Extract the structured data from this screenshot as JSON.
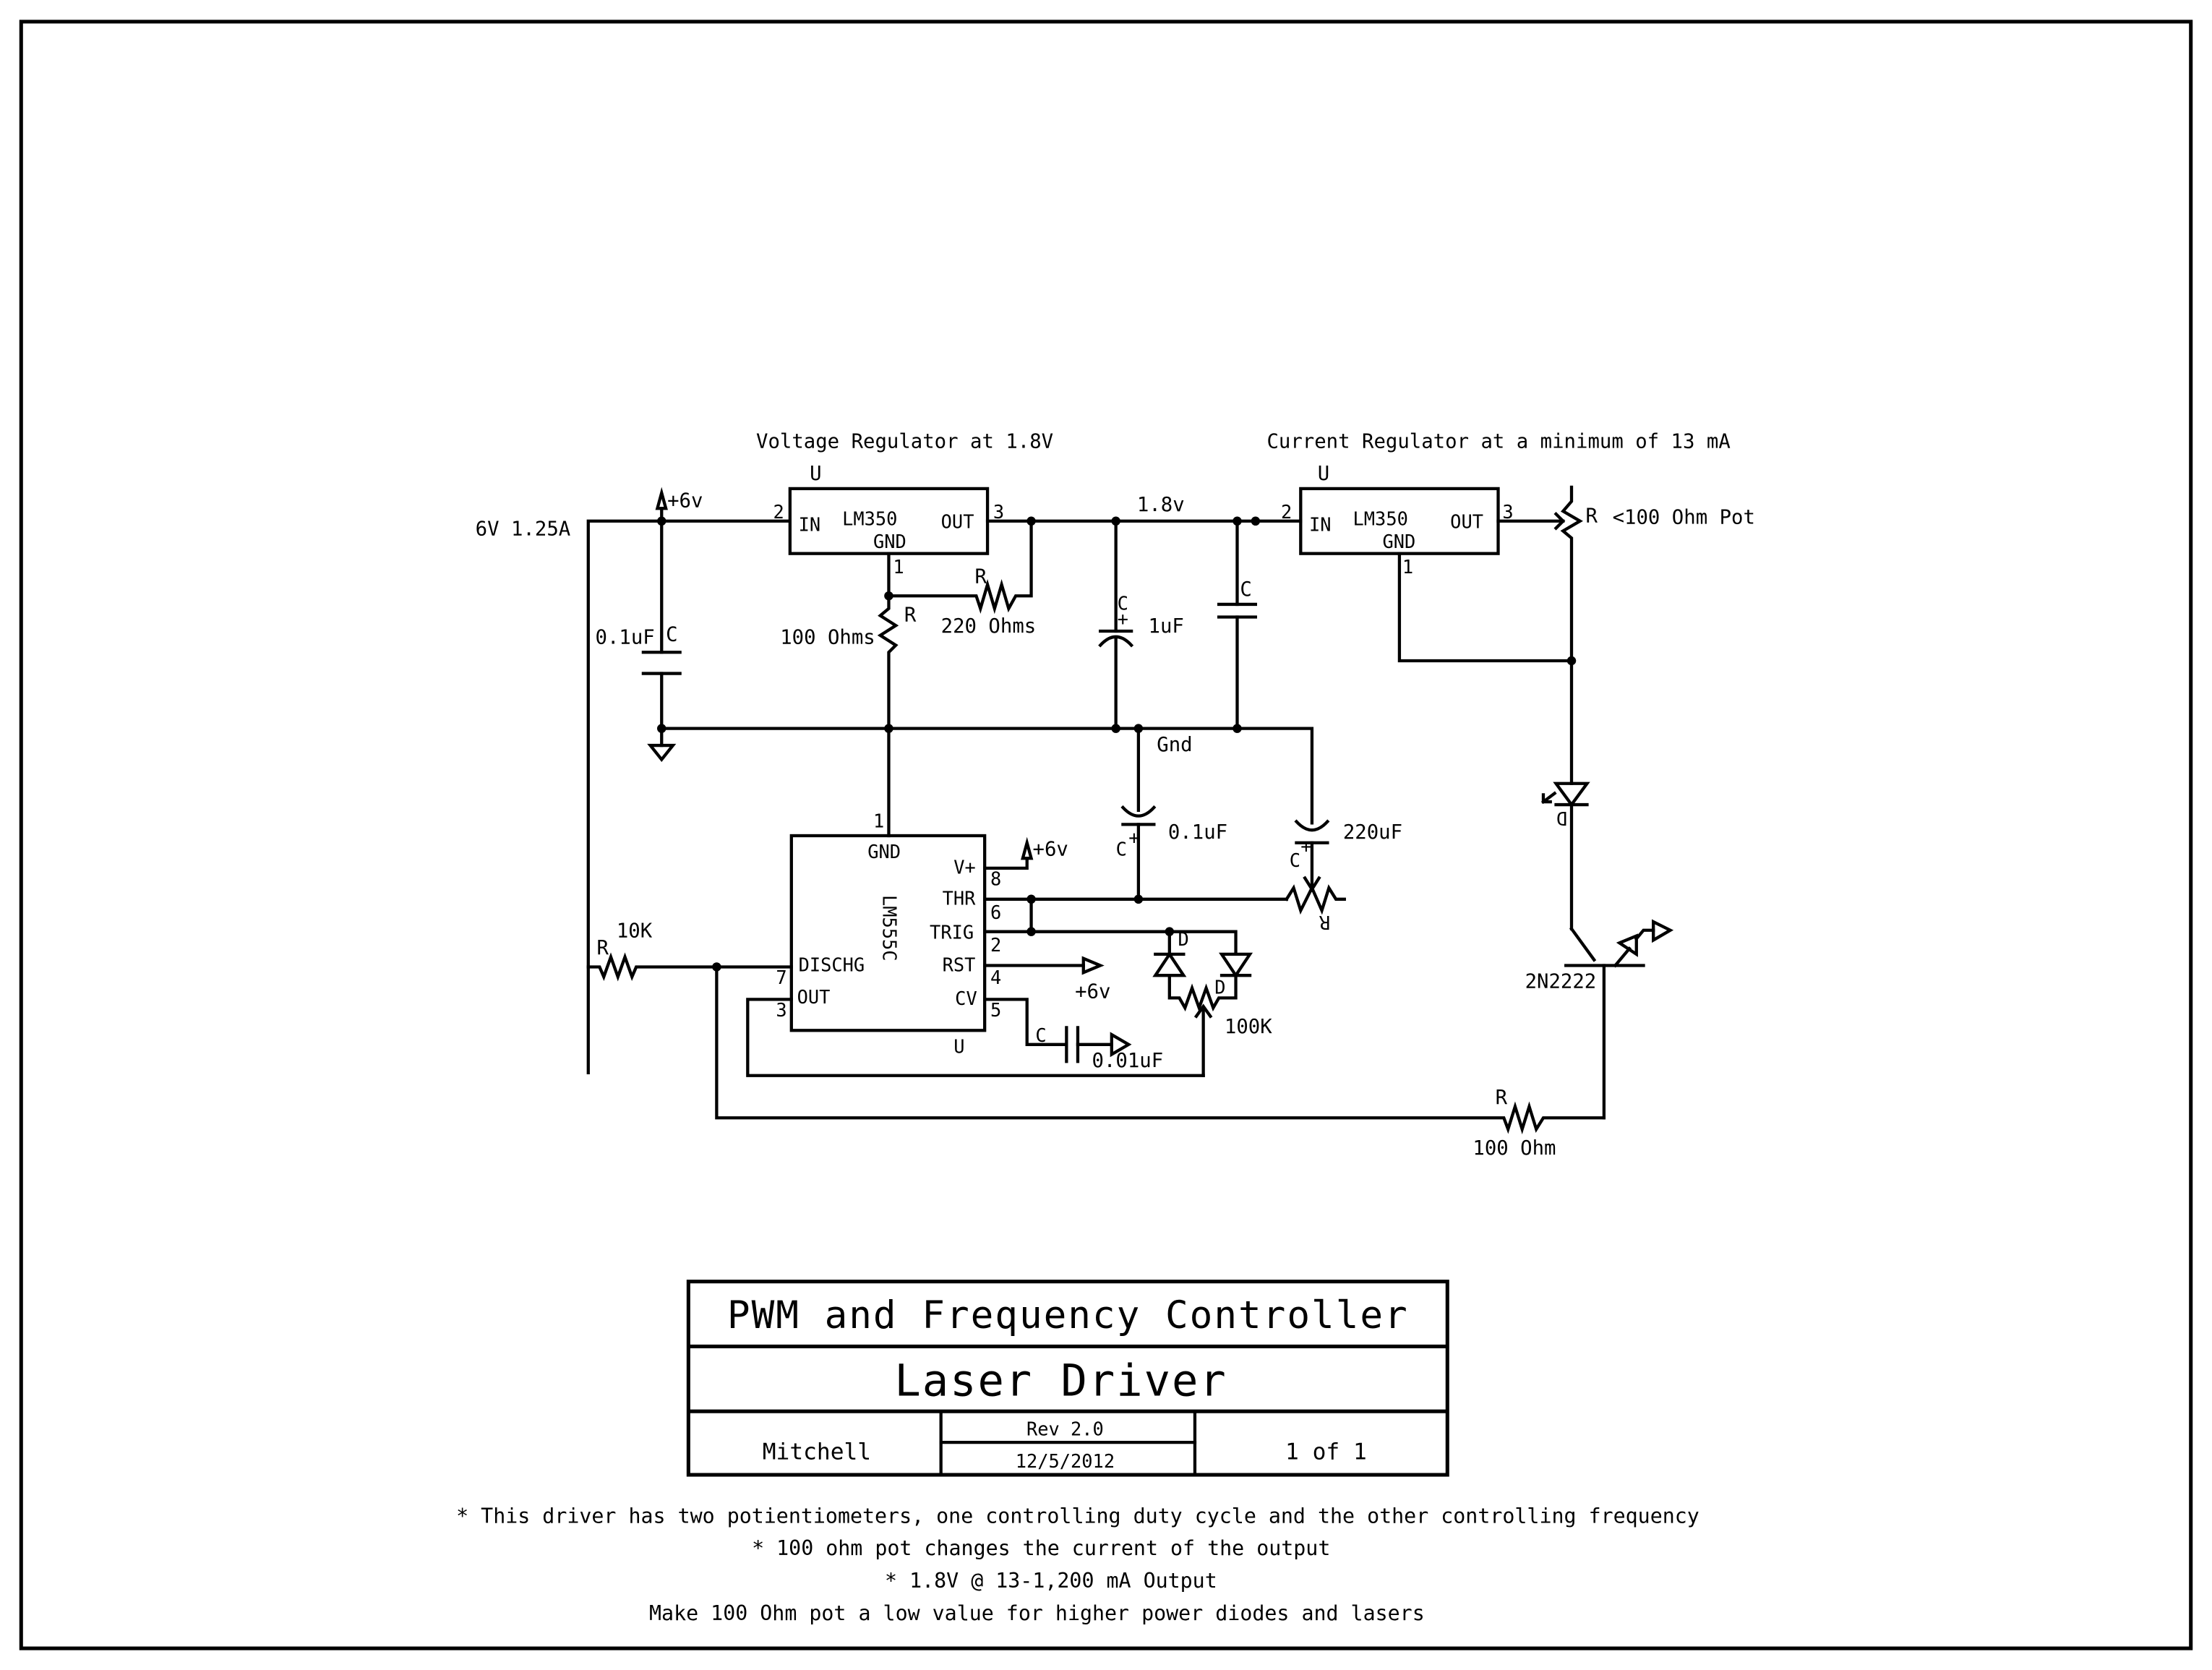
{
  "labels": {
    "vreg_title": "Voltage Regulator at 1.8V",
    "ireg_title": "Current Regulator at a minimum of 13 mA",
    "supply": "6V 1.25A",
    "plus6v": "+6v",
    "u": "U",
    "lm350": "LM350",
    "in": "IN",
    "out": "OUT",
    "gnd": "GND",
    "pin1": "1",
    "pin2": "2",
    "pin3": "3",
    "r": "R",
    "c": "C",
    "c_plus": "C",
    "r_220": "220 Ohms",
    "r_100": "100 Ohms",
    "c_01uf": "0.1uF",
    "c_1uf": "1uF",
    "net_18v": "1.8v",
    "pot_100": "<100 Ohm Pot",
    "gnd_net": "Gnd",
    "c_220uf": "220uF",
    "lm555": "LM555C",
    "v_plus": "V+",
    "thr": "THR",
    "trig": "TRIG",
    "rst": "RST",
    "cv": "CV",
    "dischg": "DISCHG",
    "pin4": "4",
    "pin5": "5",
    "pin6": "6",
    "pin7": "7",
    "pin8": "8",
    "r_10k": "10K",
    "d": "D",
    "pot_100k": "100K",
    "c_001uf": "0.01uF",
    "transistor": "2N2222",
    "r_100ohm": "100 Ohm"
  },
  "title_block": {
    "title": "PWM and Frequency Controller",
    "subtitle": "Laser Driver",
    "author": "Mitchell",
    "revision": "Rev 2.0",
    "date": "12/5/2012",
    "sheet": "1 of 1"
  },
  "notes": [
    "* This driver has two potientiometers, one controlling duty cycle and the other controlling frequency",
    "* 100 ohm pot changes the current of the output",
    "* 1.8V @ 13-1,200 mA Output",
    "Make 100 Ohm pot a low value for higher power diodes and lasers"
  ]
}
